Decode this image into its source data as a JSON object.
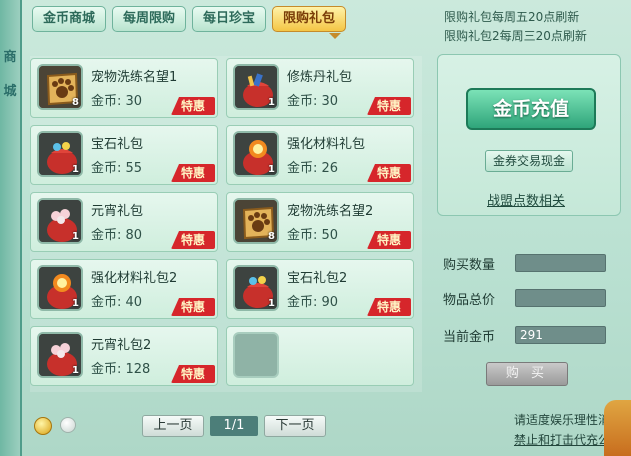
{
  "side_text": [
    "商",
    "城"
  ],
  "tabs": [
    {
      "label": "金币商城",
      "active": false
    },
    {
      "label": "每周限购",
      "active": false
    },
    {
      "label": "每日珍宝",
      "active": false
    },
    {
      "label": "限购礼包",
      "active": true
    }
  ],
  "notice": {
    "line1": "限购礼包每周五20点刷新",
    "line2": "限购礼包2每周三20点刷新"
  },
  "items": [
    {
      "name": "宠物洗练名望1",
      "price_label": "金币: 30",
      "badge": "特惠",
      "qty": "8",
      "icon": "paw-scroll-icon"
    },
    {
      "name": "修炼丹礼包",
      "price_label": "金币: 30",
      "badge": "特惠",
      "qty": "1",
      "icon": "gift-bag-icon"
    },
    {
      "name": "宝石礼包",
      "price_label": "金币: 55",
      "badge": "特惠",
      "qty": "1",
      "icon": "gift-bag-icon"
    },
    {
      "name": "强化材料礼包",
      "price_label": "金币: 26",
      "badge": "特惠",
      "qty": "1",
      "icon": "gift-bag-icon"
    },
    {
      "name": "元宵礼包",
      "price_label": "金币: 80",
      "badge": "特惠",
      "qty": "1",
      "icon": "gift-bag-icon"
    },
    {
      "name": "宠物洗练名望2",
      "price_label": "金币: 50",
      "badge": "特惠",
      "qty": "8",
      "icon": "paw-scroll-icon"
    },
    {
      "name": "强化材料礼包2",
      "price_label": "金币: 40",
      "badge": "特惠",
      "qty": "1",
      "icon": "gift-bag-icon"
    },
    {
      "name": "宝石礼包2",
      "price_label": "金币: 90",
      "badge": "特惠",
      "qty": "1",
      "icon": "gift-bag-icon"
    },
    {
      "name": "元宵礼包2",
      "price_label": "金币: 128",
      "badge": "特惠",
      "qty": "1",
      "icon": "gift-bag-icon"
    }
  ],
  "pager": {
    "prev": "上一页",
    "page": "1/1",
    "next": "下一页"
  },
  "right": {
    "recharge": "金币充值",
    "trade": "金券交易现金",
    "alliance": "战盟点数相关"
  },
  "form": {
    "qty_label": "购买数量",
    "qty_value": "",
    "total_label": "物品总价",
    "total_value": "",
    "coins_label": "当前金币",
    "coins_value": "291",
    "buy": "购 买"
  },
  "footer": {
    "line1": "请适度娱乐理性消费",
    "line2": "禁止和打击代充公告"
  },
  "colors": {
    "badge_red": "#d6262b",
    "accent_green": "#2fa57a",
    "active_tab_gold": "#f4c545"
  }
}
